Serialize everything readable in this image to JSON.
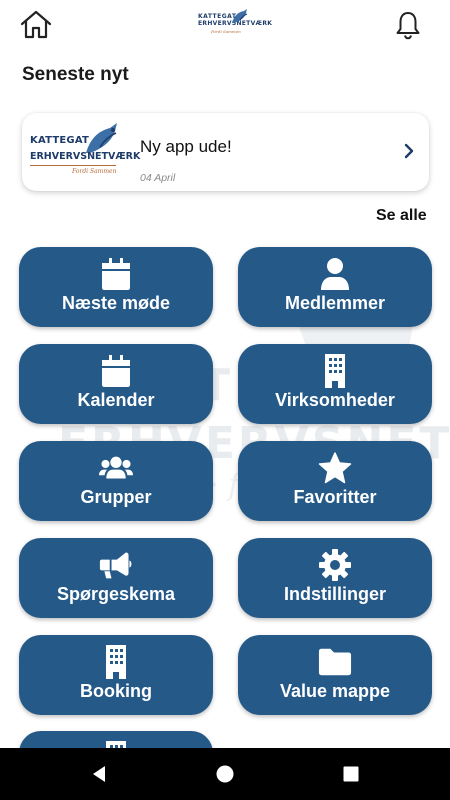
{
  "app": {
    "brand_line1": "KATTEGAT",
    "brand_line2": "ERHVERVSNETVÆRK",
    "brand_tagline": "Fordi Sammen"
  },
  "header": {
    "home_icon": "home-icon",
    "notification_icon": "bell-icon"
  },
  "news": {
    "section_title": "Seneste nyt",
    "items": [
      {
        "title": "Ny app ude!",
        "date": "04 April"
      }
    ],
    "see_all_label": "Se alle"
  },
  "tiles": [
    {
      "label": "Næste møde",
      "icon": "calendar-icon"
    },
    {
      "label": "Medlemmer",
      "icon": "user-icon"
    },
    {
      "label": "Kalender",
      "icon": "calendar-icon"
    },
    {
      "label": "Virksomheder",
      "icon": "building-icon"
    },
    {
      "label": "Grupper",
      "icon": "users-icon"
    },
    {
      "label": "Favoritter",
      "icon": "star-icon"
    },
    {
      "label": "Spørgeskema",
      "icon": "megaphone-icon"
    },
    {
      "label": "Indstillinger",
      "icon": "gear-icon"
    },
    {
      "label": "Booking",
      "icon": "building-icon"
    },
    {
      "label": "Value mappe",
      "icon": "folder-icon"
    },
    {
      "label": "",
      "icon": "building-icon"
    }
  ],
  "colors": {
    "tile_bg": "#245988",
    "brand_navy": "#1e3c6a",
    "brand_copper": "#b86a3a"
  }
}
